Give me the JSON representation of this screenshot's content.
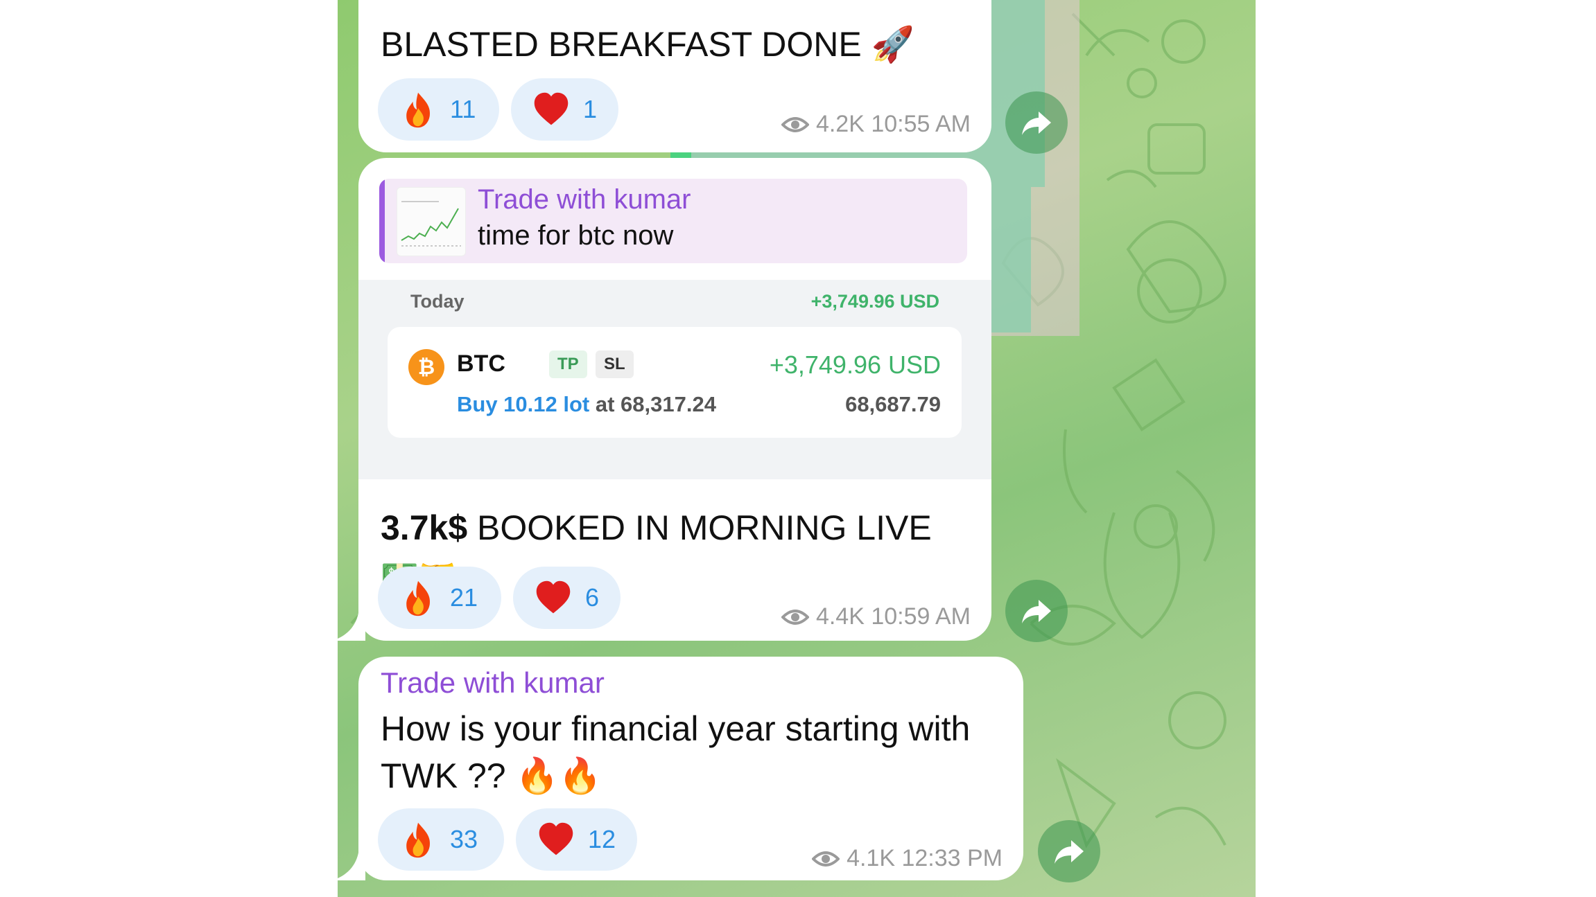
{
  "colors": {
    "sender": "#8e4ed6",
    "profit": "#3fb36a",
    "reaction_count": "#2a8de0",
    "meta": "#9a9a9a"
  },
  "messages": [
    {
      "text": "BLASTED BREAKFAST DONE 🚀",
      "reactions": [
        {
          "icon": "fire-icon",
          "count": "11"
        },
        {
          "icon": "heart-icon",
          "count": "1"
        }
      ],
      "views": "4.2K",
      "time": "10:55 AM"
    },
    {
      "reply": {
        "sender": "Trade with kumar",
        "text": "time for btc now"
      },
      "trade": {
        "today_label": "Today",
        "today_pnl": "+3,749.96 USD",
        "symbol": "BTC",
        "tags": [
          "TP",
          "SL"
        ],
        "pnl": "+3,749.96 USD",
        "order_prefix": "Buy 10.12 lot",
        "order_suffix": "at 68,317.24",
        "current_price": "68,687.79"
      },
      "text_bold": "3.7k$",
      "text_rest": " BOOKED IN MORNING LIVE",
      "text_line2": "💵🤝",
      "reactions": [
        {
          "icon": "fire-icon",
          "count": "21"
        },
        {
          "icon": "heart-icon",
          "count": "6"
        }
      ],
      "views": "4.4K",
      "time": "10:59 AM"
    },
    {
      "sender": "Trade with kumar",
      "line1": "How is your financial year starting with",
      "line2": "TWK ?? 🔥🔥",
      "reactions": [
        {
          "icon": "fire-icon",
          "count": "33"
        },
        {
          "icon": "heart-icon",
          "count": "12"
        }
      ],
      "views": "4.1K",
      "time": "12:33 PM"
    }
  ]
}
